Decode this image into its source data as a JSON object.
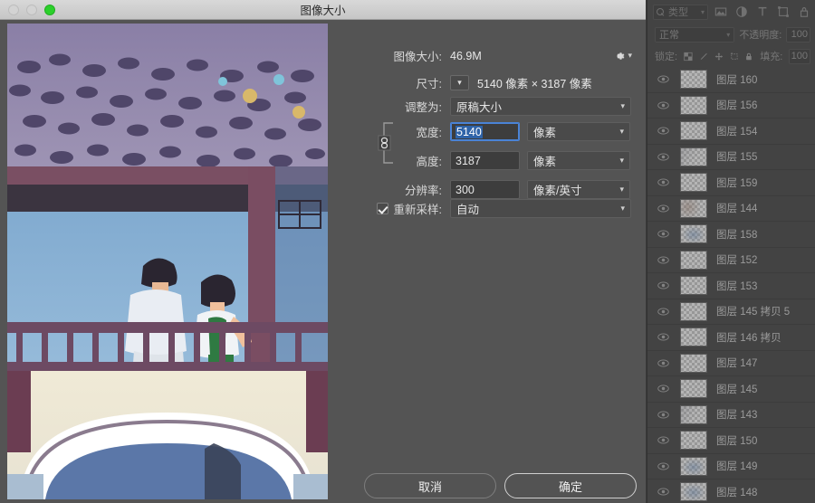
{
  "window": {
    "title": "图像大小",
    "traffic_lights": [
      {
        "name": "close-button",
        "color": "#d3d3d3",
        "state": "inactive"
      },
      {
        "name": "minimize-button",
        "color": "#d3d3d3",
        "state": "inactive"
      },
      {
        "name": "zoom-button",
        "color": "#2bd02b",
        "state": "active"
      }
    ]
  },
  "dialog": {
    "image_size": {
      "label": "图像大小:",
      "value": "46.9M"
    },
    "gear_icon": "gear-icon",
    "dimensions": {
      "label": "尺寸:",
      "value": "5140 像素 × 3187 像素",
      "width_px": "5140",
      "height_px": "3187",
      "unit": "像素",
      "separator": "×"
    },
    "fit_to": {
      "label": "调整为:",
      "value": "原稿大小"
    },
    "width": {
      "label": "宽度:",
      "value": "5140",
      "unit": "像素",
      "focused": true,
      "selected": true
    },
    "height": {
      "label": "高度:",
      "value": "3187",
      "unit": "像素"
    },
    "resolution": {
      "label": "分辨率:",
      "value": "300",
      "unit": "像素/英寸"
    },
    "resample": {
      "label": "重新采样:",
      "checked": true,
      "value": "自动"
    },
    "link_icon": "chain-link-icon",
    "buttons": {
      "cancel": "取消",
      "ok": "确定"
    }
  },
  "preview": {
    "alt": "水彩画 — 紫藤花架下桥上的两个人",
    "colors": {
      "wisteria": "#8b7fa3",
      "wisteria_dark": "#4a4060",
      "sky": "#7fa8cf",
      "rail": "#6d4a63",
      "water": "#5b77a8",
      "paper": "#efe9d7"
    }
  },
  "layers_panel": {
    "filter": {
      "label": "类型",
      "icon": "search-icon"
    },
    "filter_icons": [
      "image-filter-icon",
      "adjustment-filter-icon",
      "text-filter-icon",
      "shape-filter-icon",
      "smartobject-filter-icon"
    ],
    "blend_mode": "正常",
    "opacity": {
      "label": "不透明度:",
      "value": "100"
    },
    "lock": {
      "label": "锁定:",
      "icons": [
        "lock-transparency-icon",
        "lock-image-icon",
        "lock-position-icon",
        "lock-artboard-icon",
        "lock-all-icon"
      ]
    },
    "fill": {
      "label": "填充:",
      "value": "100"
    },
    "layers": [
      {
        "name": "图层 160",
        "visible": true,
        "thumb": "empty"
      },
      {
        "name": "图层 156",
        "visible": true,
        "thumb": "empty"
      },
      {
        "name": "图层 154",
        "visible": true,
        "thumb": "empty"
      },
      {
        "name": "图层 155",
        "visible": true,
        "thumb": "faint-gray"
      },
      {
        "name": "图层 159",
        "visible": true,
        "thumb": "empty"
      },
      {
        "name": "图层 144",
        "visible": true,
        "thumb": "faint-warm"
      },
      {
        "name": "图层 158",
        "visible": true,
        "thumb": "faint-blue"
      },
      {
        "name": "图层 152",
        "visible": true,
        "thumb": "empty"
      },
      {
        "name": "图层 153",
        "visible": true,
        "thumb": "empty"
      },
      {
        "name": "图层 145 拷贝 5",
        "visible": true,
        "thumb": "empty"
      },
      {
        "name": "图层 146 拷贝",
        "visible": true,
        "thumb": "empty"
      },
      {
        "name": "图层 147",
        "visible": true,
        "thumb": "empty"
      },
      {
        "name": "图层 145",
        "visible": true,
        "thumb": "empty"
      },
      {
        "name": "图层 143",
        "visible": true,
        "thumb": "faint-gray"
      },
      {
        "name": "图层 150",
        "visible": true,
        "thumb": "empty"
      },
      {
        "name": "图层 149",
        "visible": true,
        "thumb": "faint-blue"
      },
      {
        "name": "图层 148",
        "visible": true,
        "thumb": "faint-blue"
      }
    ]
  }
}
